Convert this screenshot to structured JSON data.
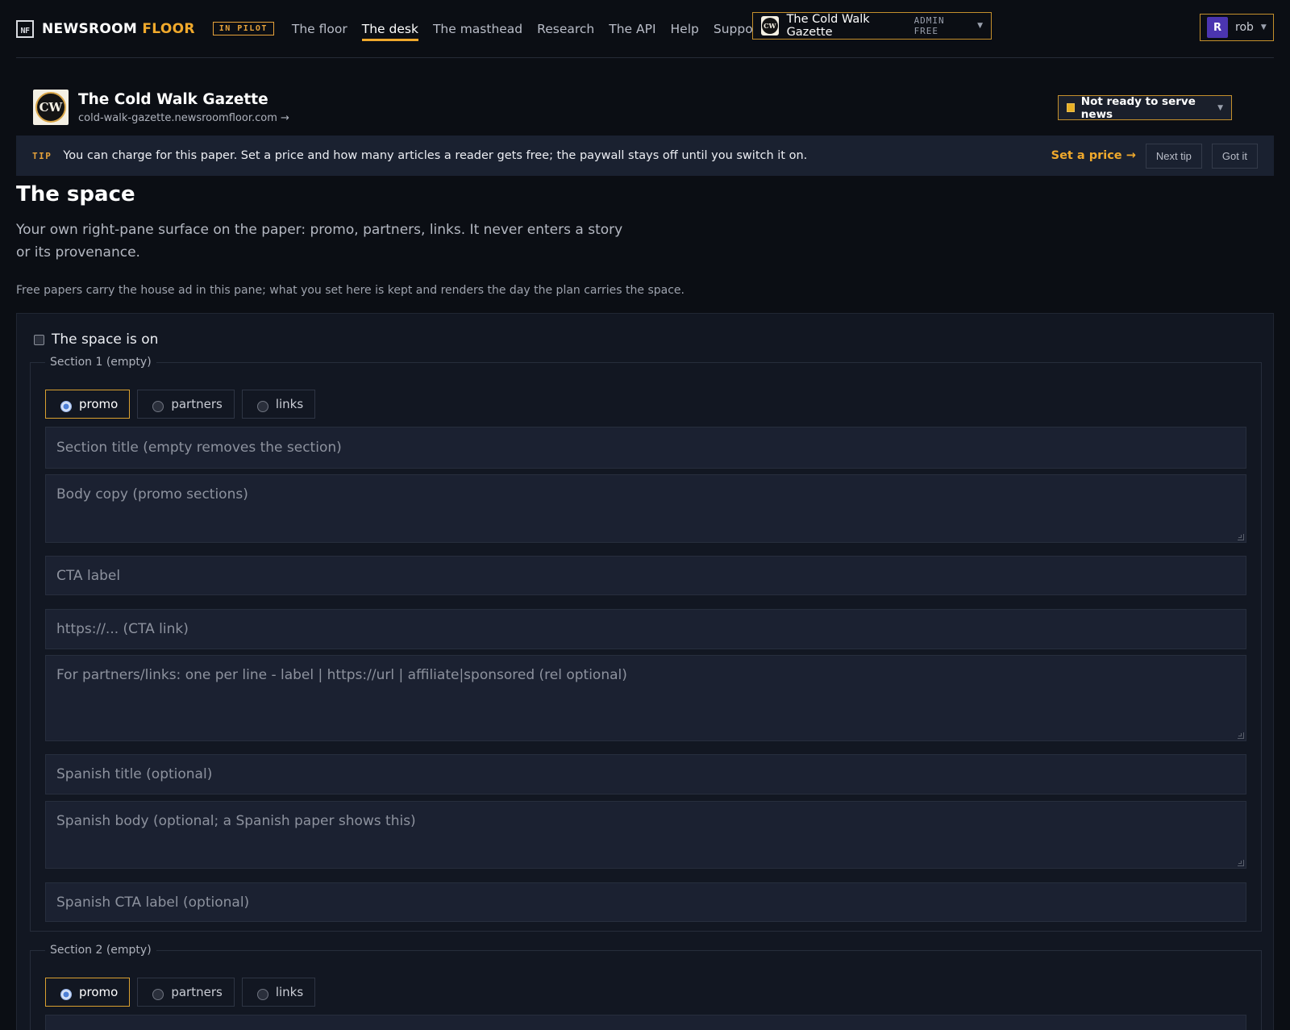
{
  "brand": {
    "logo": "NF",
    "name_a": "NEWSROOM",
    "name_b": "FLOOR",
    "badge": "IN PILOT"
  },
  "nav": {
    "links": [
      "The floor",
      "The desk",
      "The masthead",
      "Research",
      "The API",
      "Help",
      "Support"
    ],
    "active": "The desk"
  },
  "paper_switch": {
    "logo": "CW",
    "name": "The Cold Walk Gazette",
    "role": "ADMIN FREE"
  },
  "user": {
    "initial": "R",
    "name": "rob"
  },
  "paper": {
    "logo": "CW",
    "title": "The Cold Walk Gazette",
    "url": "cold-walk-gazette.newsroomfloor.com →",
    "status": "Not ready to serve news"
  },
  "tip": {
    "label": "TIP",
    "text": "You can charge for this paper. Set a price and how many articles a reader gets free; the paywall stays off until you switch it on.",
    "cta": "Set a price →",
    "next": "Next tip",
    "dismiss": "Got it"
  },
  "page": {
    "title": "The space",
    "lede": "Your own right-pane surface on the paper: promo, partners, links. It never enters a story or its provenance.",
    "note": "Free papers carry the house ad in this pane; what you set here is kept and renders the day the plan carries the space."
  },
  "space": {
    "toggle_label": "The space is on",
    "checked": false,
    "kinds": [
      "promo",
      "partners",
      "links"
    ],
    "sections": [
      {
        "legend": "Section 1 (empty)",
        "selected_kind": "promo",
        "placeholders": {
          "title": "Section title (empty removes the section)",
          "body": "Body copy (promo sections)",
          "cta_label": "CTA label",
          "cta_link": "https://... (CTA link)",
          "items": "For partners/links: one per line - label | https://url | affiliate|sponsored (rel optional)",
          "es_title": "Spanish title (optional)",
          "es_body": "Spanish body (optional; a Spanish paper shows this)",
          "es_cta": "Spanish CTA label (optional)"
        }
      },
      {
        "legend": "Section 2 (empty)",
        "selected_kind": "promo"
      }
    ]
  },
  "colors": {
    "accent": "#f0a92c",
    "background": "#0b0e14",
    "panel": "#121722",
    "field": "#1b2131"
  }
}
